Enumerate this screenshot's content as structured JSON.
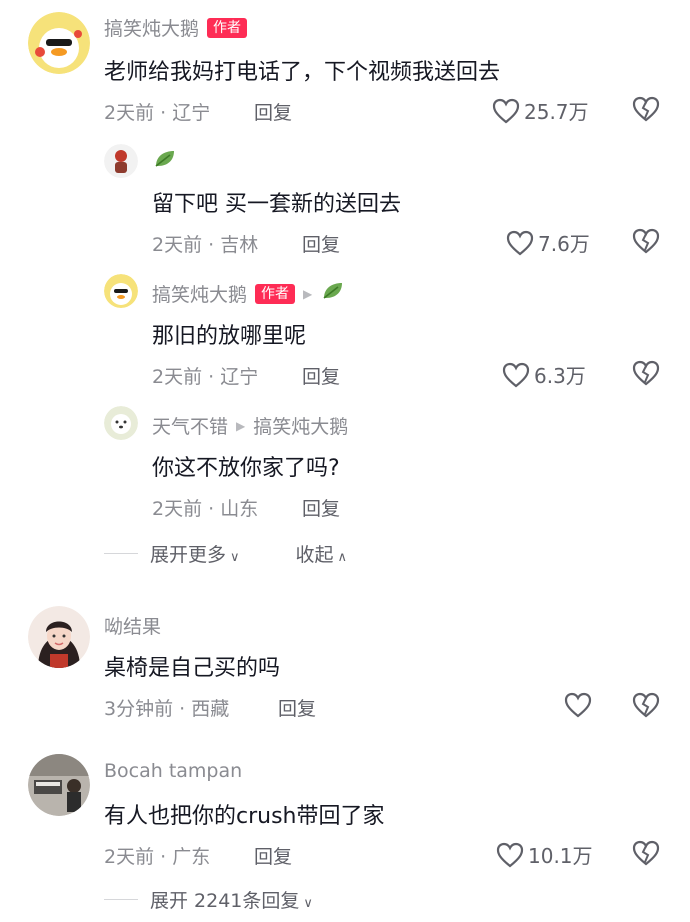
{
  "colors": {
    "accent": "#fe2c55",
    "muted": "#8a8b91",
    "text": "#161823"
  },
  "comments": [
    {
      "user": "搞笑炖大鹅",
      "badge": "作者",
      "text": "老师给我妈打电话了，下个视频我送回去",
      "meta": "2天前 · 辽宁",
      "reply": "回复",
      "likes": "25.7万",
      "replies": [
        {
          "user": "",
          "emoji": "leaf-emoji",
          "text": "留下吧 买一套新的送回去",
          "meta": "2天前 · 吉林",
          "reply": "回复",
          "likes": "7.6万"
        },
        {
          "user": "搞笑炖大鹅",
          "badge": "作者",
          "reply_to": "",
          "text": "那旧的放哪里呢",
          "meta": "2天前 · 辽宁",
          "reply": "回复",
          "likes": "6.3万"
        },
        {
          "user": "天气不错",
          "reply_to": "搞笑炖大鹅",
          "text": "你这不放你家了吗?",
          "meta": "2天前 · 山东",
          "reply": "回复",
          "likes": ""
        }
      ],
      "expand_more": "展开更多",
      "collapse": "收起"
    },
    {
      "user": "呦结果",
      "text": "桌椅是自己买的吗",
      "meta": "3分钟前 · 西藏",
      "reply": "回复",
      "likes": ""
    },
    {
      "user": "Bocah tampan",
      "text": "有人也把你的crush带回了家",
      "meta": "2天前 · 广东",
      "reply": "回复",
      "likes": "10.1万",
      "expand": "展开 2241条回复"
    }
  ]
}
